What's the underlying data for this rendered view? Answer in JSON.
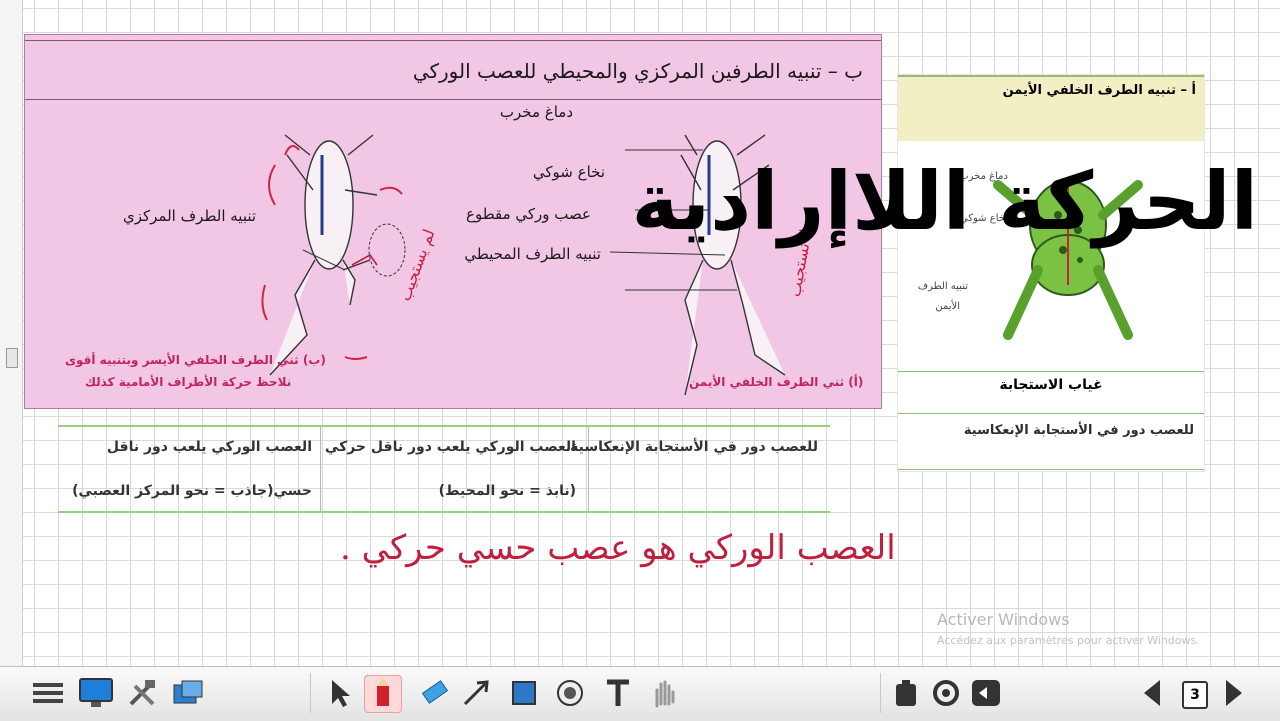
{
  "headline": "الحركة اللاإرادية",
  "panel_b": {
    "title": "ب – تنبيه الطرفين المركزي والمحيطي للعصب الوركي",
    "labels": {
      "brain": "دماغ مخرب",
      "spinal": "نخاع شوكي",
      "cut_nerve": "عصب وركي مقطوع",
      "peripheral": "تنبيه الطرف المحيطي",
      "central": "تنبيه الطرف المركزي"
    },
    "caption_left_1": "(ب) ثني الطرف الخلفي الأيسر وبتنبيه أقوى",
    "caption_left_2": "نلاحظ حركة الأطراف الأمامية كذلك",
    "caption_right": "(أ) ثني الطرف الخلفي الأيمن",
    "annotation_1": "لم يستجيب",
    "annotation_2": "لا تستجيب"
  },
  "panel_a": {
    "title": "أ – تنبيه الطرف الخلفي الأيمن",
    "brain_label": "دماغ مخرب",
    "spinal_label": "نخاع شوكي",
    "stim_label_1": "تنبيه الطرف",
    "stim_label_2": "الأيمن",
    "absence": "غياب الاستجابة",
    "role": "للعصب دور في الأستجابة الإنعكاسية"
  },
  "table": {
    "col3": "للعصب دور في الأستجابة الإنعكاسية",
    "col2_line1": "العصب الوركي يلعب دور ناقل حركي",
    "col2_line2": "(نابذ = نحو المحيط)",
    "col1_line1": "العصب الوركي يلعب دور ناقل",
    "col1_line2": "حسي(جاذب = نحو المركز العصبي)"
  },
  "handwriting": "العصب الوركي هو عصب حسي حركي .",
  "watermark": {
    "line1": "Activer Windows",
    "line2": "Accédez aux paramètres pour activer Windows."
  },
  "toolbar": {
    "page_number": "3",
    "accent": "#1e7fd8"
  }
}
